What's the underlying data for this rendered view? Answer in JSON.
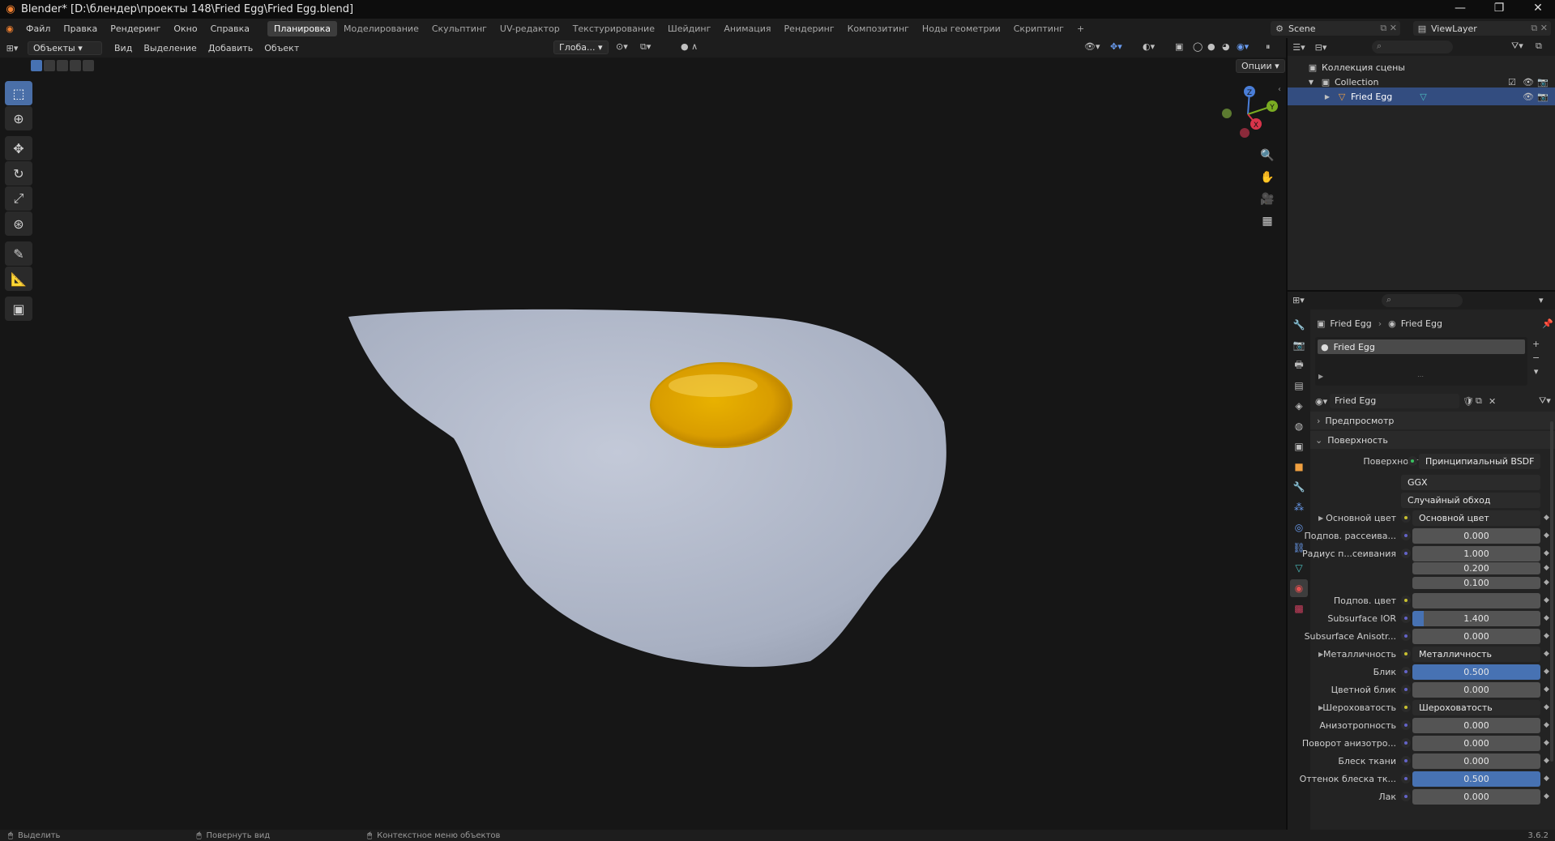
{
  "window": {
    "title": "Blender* [D:\\блендер\\проекты 148\\Fried Egg\\Fried Egg.blend]",
    "minimize": "—",
    "maximize": "❐",
    "close": "✕"
  },
  "menu": [
    "Файл",
    "Правка",
    "Рендеринг",
    "Окно",
    "Справка"
  ],
  "workspaces": [
    "Планировка",
    "Моделирование",
    "Скульптинг",
    "UV-редактор",
    "Текстурирование",
    "Шейдинг",
    "Анимация",
    "Рендеринг",
    "Композитинг",
    "Ноды геометрии",
    "Скриптинг"
  ],
  "workspace_add": "+",
  "scene_name": "Scene",
  "view_layer": "ViewLayer",
  "viewport_header": {
    "mode": "Объекты",
    "menus": [
      "Вид",
      "Выделение",
      "Добавить",
      "Объект"
    ],
    "orientation": "Глоба...",
    "options": "Опции"
  },
  "outliner": {
    "root": "Коллекция сцены",
    "collection": "Collection",
    "object": "Fried Egg"
  },
  "properties": {
    "breadcrumb_object": "Fried Egg",
    "breadcrumb_material": "Fried Egg",
    "material_slot": "Fried Egg",
    "material_name": "Fried Egg",
    "panel_preview": "Предпросмотр",
    "panel_surface": "Поверхность",
    "surface_label": "Поверхность",
    "surface_value": "Принципиальный BSDF",
    "distribution": "GGX",
    "subsurface_method": "Случайный обход",
    "rows": [
      {
        "label": "Основной цвет",
        "value": "Основной цвет",
        "kind": "link"
      },
      {
        "label": "Подпов. рассеива...",
        "value": "0.000",
        "kind": "num"
      },
      {
        "label": "Радиус п...сеивания",
        "value": "1.000",
        "kind": "num"
      },
      {
        "label": "",
        "value": "0.200",
        "kind": "num"
      },
      {
        "label": "",
        "value": "0.100",
        "kind": "num"
      },
      {
        "label": "Подпов. цвет",
        "value": "",
        "kind": "color"
      },
      {
        "label": "Subsurface IOR",
        "value": "1.400",
        "kind": "num"
      },
      {
        "label": "Subsurface Anisotr...",
        "value": "0.000",
        "kind": "num"
      },
      {
        "label": "Металличность",
        "value": "Металличность",
        "kind": "link"
      },
      {
        "label": "Блик",
        "value": "0.500",
        "kind": "blue"
      },
      {
        "label": "Цветной блик",
        "value": "0.000",
        "kind": "num"
      },
      {
        "label": "Шероховатость",
        "value": "Шероховатость",
        "kind": "link"
      },
      {
        "label": "Анизотропность",
        "value": "0.000",
        "kind": "num"
      },
      {
        "label": "Поворот анизотро...",
        "value": "0.000",
        "kind": "num"
      },
      {
        "label": "Блеск ткани",
        "value": "0.000",
        "kind": "num"
      },
      {
        "label": "Оттенок блеска тк...",
        "value": "0.500",
        "kind": "blue"
      },
      {
        "label": "Лак",
        "value": "0.000",
        "kind": "num"
      }
    ]
  },
  "status": {
    "select": "Выделить",
    "rotate": "Повернуть вид",
    "context": "Контекстное меню объектов",
    "version": "3.6.2"
  },
  "gizmo": {
    "x": "X",
    "y": "Y",
    "z": "Z"
  }
}
